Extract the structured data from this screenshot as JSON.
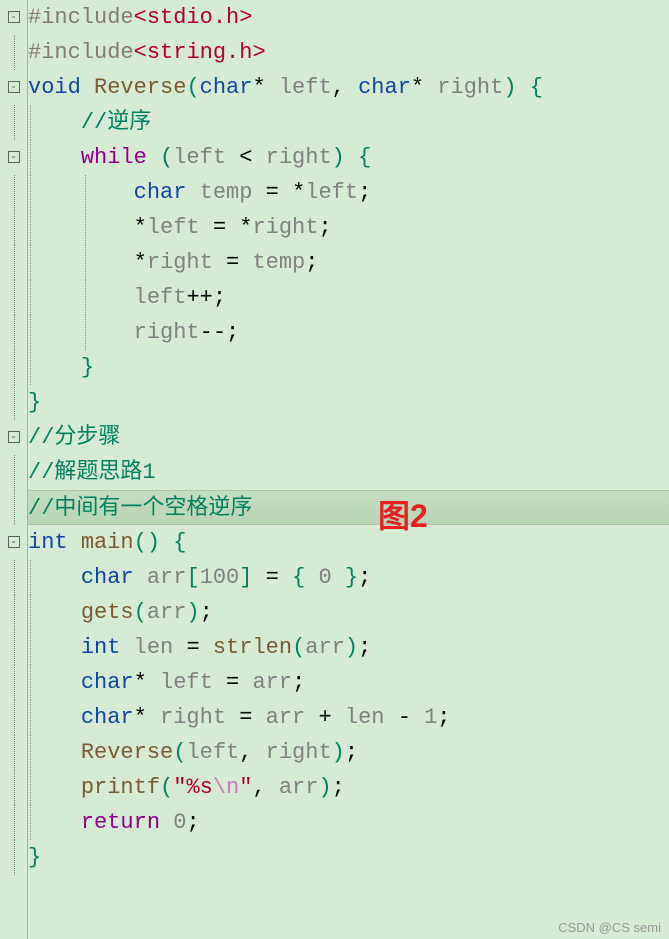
{
  "annotation": "图2",
  "watermark": "CSDN @CS semi",
  "gutter": [
    {
      "sym": "⊟"
    },
    {
      "sym": ""
    },
    {
      "sym": "⊟"
    },
    {
      "sym": ""
    },
    {
      "sym": "⊟"
    },
    {
      "sym": ""
    },
    {
      "sym": ""
    },
    {
      "sym": ""
    },
    {
      "sym": ""
    },
    {
      "sym": ""
    },
    {
      "sym": ""
    },
    {
      "sym": ""
    },
    {
      "sym": "⊟"
    },
    {
      "sym": ""
    },
    {
      "sym": ""
    },
    {
      "sym": "⊟"
    },
    {
      "sym": ""
    },
    {
      "sym": ""
    },
    {
      "sym": ""
    },
    {
      "sym": ""
    },
    {
      "sym": ""
    },
    {
      "sym": ""
    },
    {
      "sym": ""
    },
    {
      "sym": ""
    },
    {
      "sym": ""
    }
  ],
  "lines": [
    {
      "tokens": [
        [
          "kw-preproc",
          "#include"
        ],
        [
          "kw-header",
          "<stdio.h>"
        ]
      ]
    },
    {
      "tokens": [
        [
          "kw-preproc",
          "#include"
        ],
        [
          "kw-header",
          "<string.h>"
        ]
      ]
    },
    {
      "tokens": [
        [
          "kw-type",
          "void"
        ],
        [
          "",
          " "
        ],
        [
          "kw-func",
          "Reverse"
        ],
        [
          "kw-paren",
          "("
        ],
        [
          "kw-type",
          "char"
        ],
        [
          "kw-op",
          "*"
        ],
        [
          "",
          " "
        ],
        [
          "kw-var",
          "left"
        ],
        [
          "kw-punct",
          ", "
        ],
        [
          "kw-type",
          "char"
        ],
        [
          "kw-op",
          "*"
        ],
        [
          "",
          " "
        ],
        [
          "kw-var",
          "right"
        ],
        [
          "kw-paren",
          ")"
        ],
        [
          "",
          " "
        ],
        [
          "kw-brace",
          "{"
        ]
      ]
    },
    {
      "indent": 1,
      "tokens": [
        [
          "",
          "    "
        ],
        [
          "kw-comment",
          "//逆序"
        ]
      ]
    },
    {
      "indent": 1,
      "tokens": [
        [
          "",
          "    "
        ],
        [
          "kw-keyword",
          "while"
        ],
        [
          "",
          " "
        ],
        [
          "kw-paren",
          "("
        ],
        [
          "kw-var",
          "left"
        ],
        [
          "",
          " "
        ],
        [
          "kw-op",
          "<"
        ],
        [
          "",
          " "
        ],
        [
          "kw-var",
          "right"
        ],
        [
          "kw-paren",
          ")"
        ],
        [
          "",
          " "
        ],
        [
          "kw-brace",
          "{"
        ]
      ]
    },
    {
      "indent": 2,
      "tokens": [
        [
          "",
          "        "
        ],
        [
          "kw-type",
          "char"
        ],
        [
          "",
          " "
        ],
        [
          "kw-var",
          "temp"
        ],
        [
          "",
          " "
        ],
        [
          "kw-op",
          "="
        ],
        [
          "",
          " "
        ],
        [
          "kw-op",
          "*"
        ],
        [
          "kw-var",
          "left"
        ],
        [
          "kw-punct",
          ";"
        ]
      ]
    },
    {
      "indent": 2,
      "tokens": [
        [
          "",
          "        "
        ],
        [
          "kw-op",
          "*"
        ],
        [
          "kw-var",
          "left"
        ],
        [
          "",
          " "
        ],
        [
          "kw-op",
          "="
        ],
        [
          "",
          " "
        ],
        [
          "kw-op",
          "*"
        ],
        [
          "kw-var",
          "right"
        ],
        [
          "kw-punct",
          ";"
        ]
      ]
    },
    {
      "indent": 2,
      "tokens": [
        [
          "",
          "        "
        ],
        [
          "kw-op",
          "*"
        ],
        [
          "kw-var",
          "right"
        ],
        [
          "",
          " "
        ],
        [
          "kw-op",
          "="
        ],
        [
          "",
          " "
        ],
        [
          "kw-var",
          "temp"
        ],
        [
          "kw-punct",
          ";"
        ]
      ]
    },
    {
      "indent": 2,
      "tokens": [
        [
          "",
          "        "
        ],
        [
          "kw-var",
          "left"
        ],
        [
          "kw-op",
          "++"
        ],
        [
          "kw-punct",
          ";"
        ]
      ]
    },
    {
      "indent": 2,
      "tokens": [
        [
          "",
          "        "
        ],
        [
          "kw-var",
          "right"
        ],
        [
          "kw-op",
          "--"
        ],
        [
          "kw-punct",
          ";"
        ]
      ]
    },
    {
      "indent": 1,
      "tokens": [
        [
          "",
          "    "
        ],
        [
          "kw-brace",
          "}"
        ]
      ]
    },
    {
      "tokens": [
        [
          "kw-brace",
          "}"
        ]
      ]
    },
    {
      "tokens": [
        [
          "kw-comment",
          "//分步骤"
        ]
      ]
    },
    {
      "tokens": [
        [
          "kw-comment",
          "//解题思路1"
        ]
      ]
    },
    {
      "highlight": true,
      "tokens": [
        [
          "kw-comment",
          "//中间有一个空格逆序"
        ]
      ]
    },
    {
      "tokens": [
        [
          "kw-type",
          "int"
        ],
        [
          "",
          " "
        ],
        [
          "kw-func",
          "main"
        ],
        [
          "kw-paren",
          "()"
        ],
        [
          "",
          " "
        ],
        [
          "kw-brace",
          "{"
        ]
      ]
    },
    {
      "indent": 1,
      "tokens": [
        [
          "",
          "    "
        ],
        [
          "kw-type",
          "char"
        ],
        [
          "",
          " "
        ],
        [
          "kw-var",
          "arr"
        ],
        [
          "kw-bracket",
          "["
        ],
        [
          "kw-num",
          "100"
        ],
        [
          "kw-bracket",
          "]"
        ],
        [
          "",
          " "
        ],
        [
          "kw-op",
          "="
        ],
        [
          "",
          " "
        ],
        [
          "kw-brace",
          "{"
        ],
        [
          "",
          " "
        ],
        [
          "kw-num",
          "0"
        ],
        [
          "",
          " "
        ],
        [
          "kw-brace",
          "}"
        ],
        [
          "kw-punct",
          ";"
        ]
      ]
    },
    {
      "indent": 1,
      "tokens": [
        [
          "",
          "    "
        ],
        [
          "kw-func",
          "gets"
        ],
        [
          "kw-paren",
          "("
        ],
        [
          "kw-var",
          "arr"
        ],
        [
          "kw-paren",
          ")"
        ],
        [
          "kw-punct",
          ";"
        ]
      ]
    },
    {
      "indent": 1,
      "tokens": [
        [
          "",
          "    "
        ],
        [
          "kw-type",
          "int"
        ],
        [
          "",
          " "
        ],
        [
          "kw-var",
          "len"
        ],
        [
          "",
          " "
        ],
        [
          "kw-op",
          "="
        ],
        [
          "",
          " "
        ],
        [
          "kw-func",
          "strlen"
        ],
        [
          "kw-paren",
          "("
        ],
        [
          "kw-var",
          "arr"
        ],
        [
          "kw-paren",
          ")"
        ],
        [
          "kw-punct",
          ";"
        ]
      ]
    },
    {
      "indent": 1,
      "tokens": [
        [
          "",
          "    "
        ],
        [
          "kw-type",
          "char"
        ],
        [
          "kw-op",
          "*"
        ],
        [
          "",
          " "
        ],
        [
          "kw-var",
          "left"
        ],
        [
          "",
          " "
        ],
        [
          "kw-op",
          "="
        ],
        [
          "",
          " "
        ],
        [
          "kw-var",
          "arr"
        ],
        [
          "kw-punct",
          ";"
        ]
      ]
    },
    {
      "indent": 1,
      "tokens": [
        [
          "",
          "    "
        ],
        [
          "kw-type",
          "char"
        ],
        [
          "kw-op",
          "*"
        ],
        [
          "",
          " "
        ],
        [
          "kw-var",
          "right"
        ],
        [
          "",
          " "
        ],
        [
          "kw-op",
          "="
        ],
        [
          "",
          " "
        ],
        [
          "kw-var",
          "arr"
        ],
        [
          "",
          " "
        ],
        [
          "kw-op",
          "+"
        ],
        [
          "",
          " "
        ],
        [
          "kw-var",
          "len"
        ],
        [
          "",
          " "
        ],
        [
          "kw-op",
          "-"
        ],
        [
          "",
          " "
        ],
        [
          "kw-num",
          "1"
        ],
        [
          "kw-punct",
          ";"
        ]
      ]
    },
    {
      "indent": 1,
      "tokens": [
        [
          "",
          "    "
        ],
        [
          "kw-func",
          "Reverse"
        ],
        [
          "kw-paren",
          "("
        ],
        [
          "kw-var",
          "left"
        ],
        [
          "kw-punct",
          ", "
        ],
        [
          "kw-var",
          "right"
        ],
        [
          "kw-paren",
          ")"
        ],
        [
          "kw-punct",
          ";"
        ]
      ]
    },
    {
      "indent": 1,
      "tokens": [
        [
          "",
          "    "
        ],
        [
          "kw-func",
          "printf"
        ],
        [
          "kw-paren",
          "("
        ],
        [
          "kw-string",
          "\"%s"
        ],
        [
          "kw-escape",
          "\\n"
        ],
        [
          "kw-string",
          "\""
        ],
        [
          "kw-punct",
          ", "
        ],
        [
          "kw-var",
          "arr"
        ],
        [
          "kw-paren",
          ")"
        ],
        [
          "kw-punct",
          ";"
        ]
      ]
    },
    {
      "indent": 1,
      "tokens": [
        [
          "",
          "    "
        ],
        [
          "kw-keyword",
          "return"
        ],
        [
          "",
          " "
        ],
        [
          "kw-num",
          "0"
        ],
        [
          "kw-punct",
          ";"
        ]
      ]
    },
    {
      "tokens": [
        [
          "kw-brace",
          "}"
        ]
      ]
    }
  ]
}
